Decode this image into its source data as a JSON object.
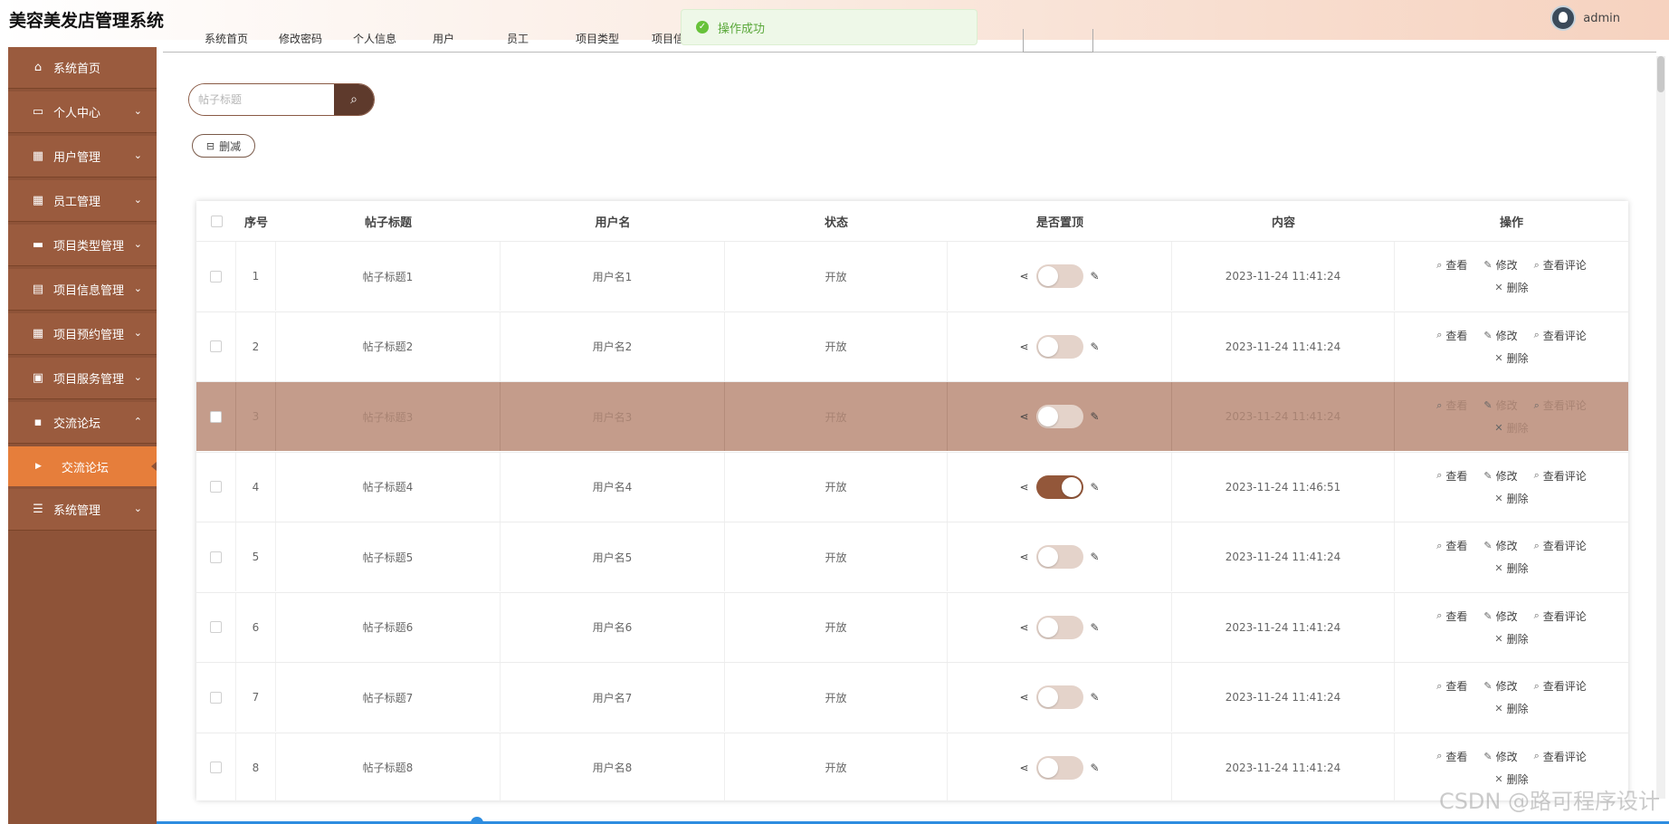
{
  "header": {
    "title": "美容美发店管理系统",
    "username": "admin"
  },
  "toast": {
    "message": "操作成功"
  },
  "tabs": [
    "系统首页",
    "修改密码",
    "个人信息",
    "用户",
    "员工",
    "项目类型",
    "项目信"
  ],
  "sidebar": {
    "items": [
      {
        "label": "系统首页",
        "icon": "home-icon"
      },
      {
        "label": "个人中心",
        "icon": "card-icon"
      },
      {
        "label": "用户管理",
        "icon": "grid-icon"
      },
      {
        "label": "员工管理",
        "icon": "grid-icon"
      },
      {
        "label": "项目类型管理",
        "icon": "monitor-icon"
      },
      {
        "label": "项目信息管理",
        "icon": "clipboard-icon"
      },
      {
        "label": "项目预约管理",
        "icon": "grid-icon"
      },
      {
        "label": "项目服务管理",
        "icon": "chart-icon"
      },
      {
        "label": "交流论坛",
        "icon": "chat-icon"
      }
    ],
    "submenu": "交流论坛",
    "last_item": {
      "label": "系统管理",
      "icon": "sliders-icon"
    }
  },
  "search": {
    "placeholder": "帖子标题"
  },
  "toolbar": {
    "delete_label": "删减"
  },
  "table": {
    "headers": [
      "序号",
      "帖子标题",
      "用户名",
      "状态",
      "是否置顶",
      "内容",
      "操作"
    ],
    "ops": {
      "view": "查看",
      "edit": "修改",
      "comments": "查看评论",
      "delete": "删除"
    },
    "rows": [
      {
        "no": "1",
        "title": "帖子标题1",
        "user": "用户名1",
        "status": "开放",
        "top": false,
        "content": "2023-11-24 11:41:24"
      },
      {
        "no": "2",
        "title": "帖子标题2",
        "user": "用户名2",
        "status": "开放",
        "top": false,
        "content": "2023-11-24 11:41:24"
      },
      {
        "no": "3",
        "title": "帖子标题3",
        "user": "用户名3",
        "status": "开放",
        "top": false,
        "content": "2023-11-24 11:41:24"
      },
      {
        "no": "4",
        "title": "帖子标题4",
        "user": "用户名4",
        "status": "开放",
        "top": true,
        "content": "2023-11-24 11:46:51"
      },
      {
        "no": "5",
        "title": "帖子标题5",
        "user": "用户名5",
        "status": "开放",
        "top": false,
        "content": "2023-11-24 11:41:24"
      },
      {
        "no": "6",
        "title": "帖子标题6",
        "user": "用户名6",
        "status": "开放",
        "top": false,
        "content": "2023-11-24 11:41:24"
      },
      {
        "no": "7",
        "title": "帖子标题7",
        "user": "用户名7",
        "status": "开放",
        "top": false,
        "content": "2023-11-24 11:41:24"
      },
      {
        "no": "8",
        "title": "帖子标题8",
        "user": "用户名8",
        "status": "开放",
        "top": false,
        "content": "2023-11-24 11:41:24"
      }
    ]
  },
  "watermark": "CSDN @路可程序设计"
}
